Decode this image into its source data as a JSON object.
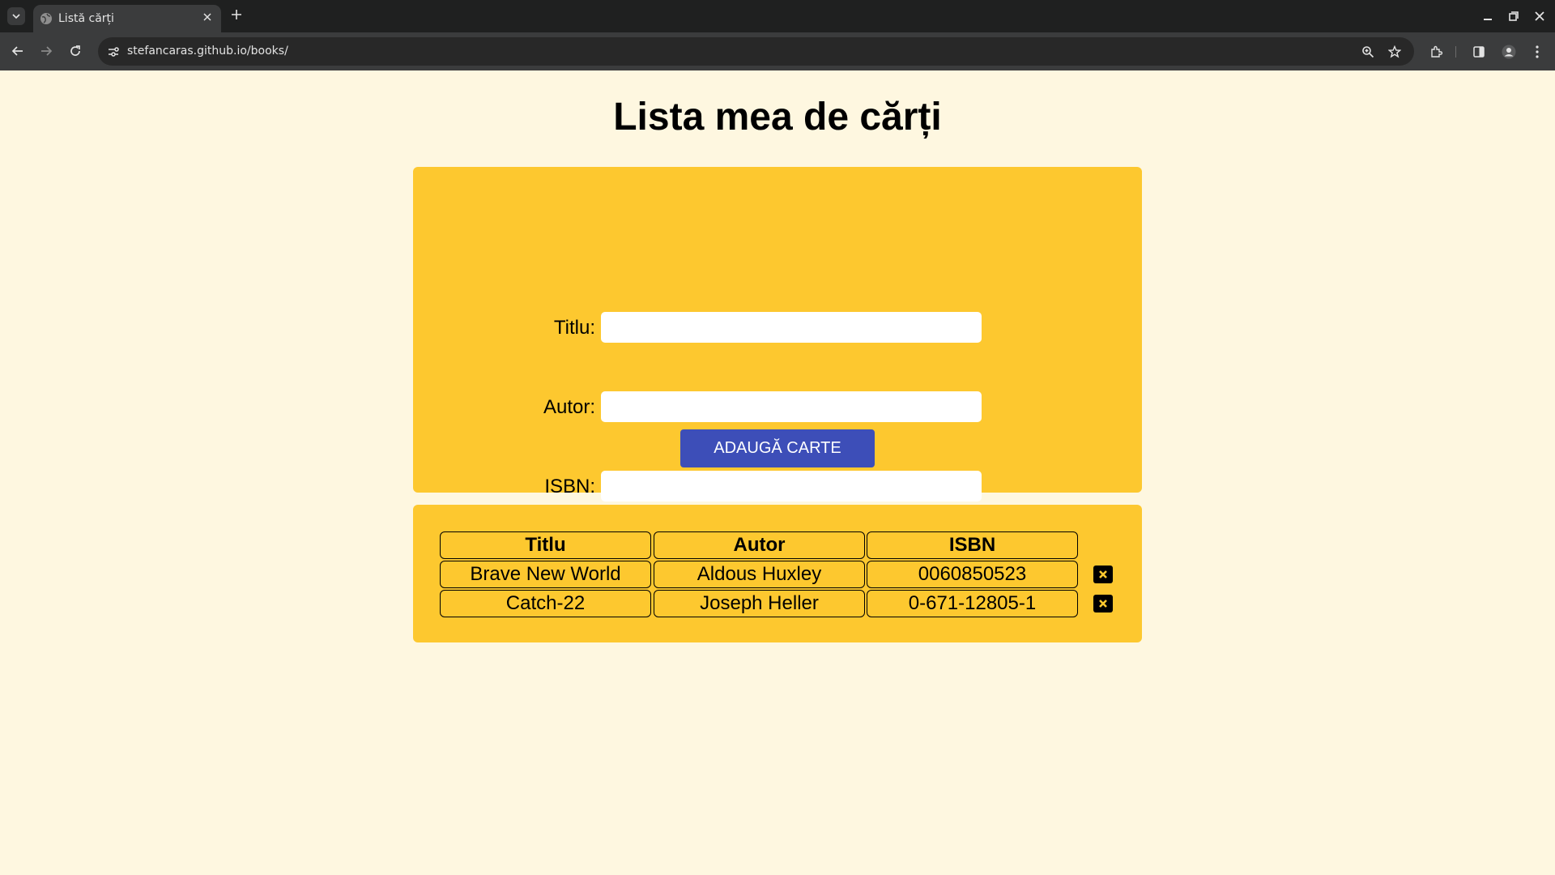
{
  "browser": {
    "tab_title": "Listă cărți",
    "url": "stefancaras.github.io/books/",
    "colors": {
      "chrome_dark": "#1f2020",
      "toolbar": "#3b3c3d",
      "omnibox": "#282828"
    },
    "icons": [
      "tab-search-icon",
      "globe-icon",
      "close-icon",
      "plus-icon",
      "minimize-icon",
      "restore-icon",
      "window-close-icon",
      "back-icon",
      "forward-icon",
      "reload-icon",
      "site-info-icon",
      "zoom-icon",
      "bookmark-star-icon",
      "extensions-icon",
      "side-panel-icon",
      "profile-icon",
      "menu-icon"
    ]
  },
  "page": {
    "title": "Lista mea de cărți",
    "colors": {
      "background": "#fef7e0",
      "card": "#fdc82f",
      "button": "#3d4eb8"
    }
  },
  "form": {
    "title_label": "Titlu:",
    "title_value": "",
    "author_label": "Autor:",
    "author_value": "",
    "isbn_label": "ISBN:",
    "isbn_value": "",
    "submit_label": "ADAUGĂ CARTE"
  },
  "table": {
    "headers": [
      "Titlu",
      "Autor",
      "ISBN"
    ],
    "rows": [
      {
        "title": "Brave New World",
        "author": "Aldous Huxley",
        "isbn": "0060850523"
      },
      {
        "title": "Catch-22",
        "author": "Joseph Heller",
        "isbn": "0-671-12805-1"
      }
    ],
    "delete_icon": "delete-x-icon"
  }
}
